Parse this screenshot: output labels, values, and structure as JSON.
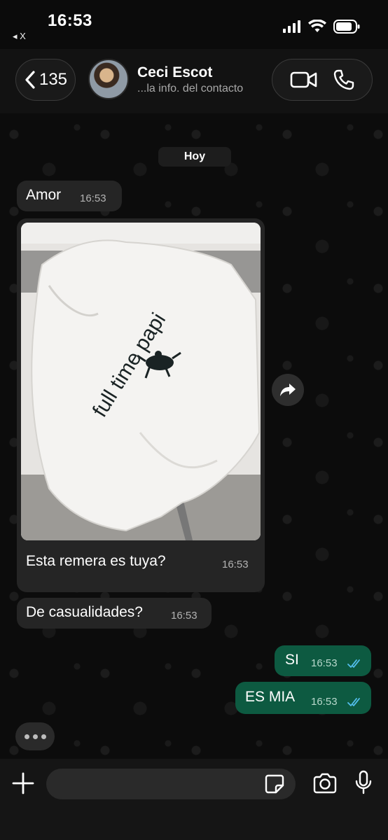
{
  "status_bar": {
    "time": "16:53",
    "back_app": "◂ X"
  },
  "header": {
    "back_count": "135",
    "contact_name": "Ceci Escot",
    "contact_subtitle": "...la info. del contacto",
    "icons": [
      "chevron-left-icon",
      "video-call-icon",
      "phone-icon"
    ]
  },
  "chat": {
    "date_chip": "Hoy",
    "messages": [
      {
        "direction": "in",
        "text": "Amor",
        "time": "16:53"
      },
      {
        "direction": "in",
        "type": "image",
        "caption": "Esta remera es tuya?",
        "time": "16:53",
        "image_text": "full time papi"
      },
      {
        "direction": "in",
        "text": "De casualidades?",
        "time": "16:53"
      },
      {
        "direction": "out",
        "text": "SI",
        "time": "16:53",
        "status": "read"
      },
      {
        "direction": "out",
        "text": "ES MIA",
        "time": "16:53",
        "status": "read"
      }
    ]
  },
  "input_bar": {
    "placeholder": "",
    "icons": [
      "plus-icon",
      "sticker-icon",
      "camera-icon",
      "microphone-icon"
    ]
  },
  "colors": {
    "outgoing_bubble": "#0d5a41",
    "incoming_bubble": "#252525",
    "read_ticks": "#53bdeb"
  }
}
